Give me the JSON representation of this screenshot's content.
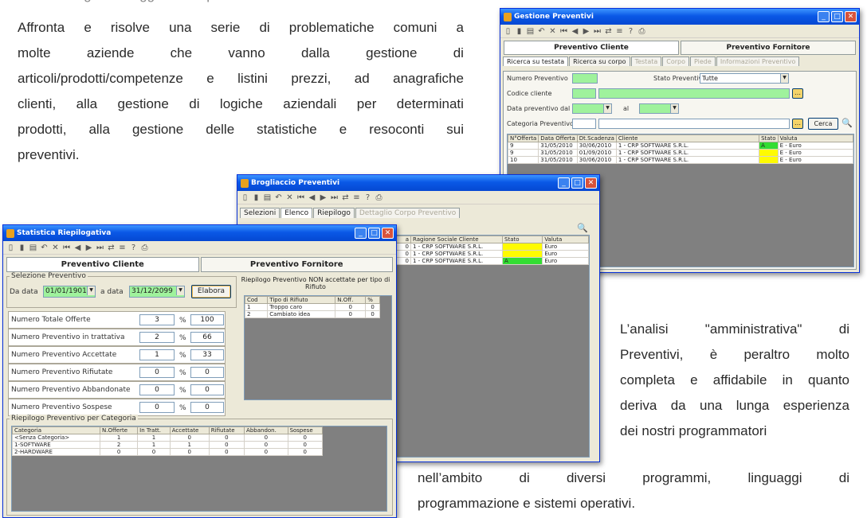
{
  "article": {
    "top_fragment": "con una seguirà in oggetto complicati ultima",
    "para1": [
      "Affronta e risolve una serie di problematiche comuni a",
      "molte aziende che vanno dalla gestione di",
      "articoli/prodotti/competenze e listini prezzi, ad anagrafiche",
      "clienti, alla gestione di logiche aziendali per determinati",
      "prodotti, alla gestione delle statistiche e resoconti sui",
      "preventivi."
    ],
    "para1_words": [
      [
        "Affronta",
        "e",
        "risolve",
        "una",
        "serie",
        "di",
        "problematiche",
        "comuni",
        "a"
      ],
      [
        "molte",
        "aziende",
        "che",
        "vanno",
        "dalla",
        "gestione",
        "di"
      ],
      [
        "articoli/prodotti/competenze",
        "e",
        "listini",
        "prezzi,",
        "ad",
        "anagrafiche"
      ],
      [
        "clienti,",
        "alla",
        "gestione",
        "di",
        "logiche",
        "aziendali",
        "per",
        "determinati"
      ],
      [
        "prodotti,",
        "alla",
        "gestione",
        "delle",
        "statistiche",
        "e",
        "resoconti",
        "sui"
      ]
    ],
    "para2_words": [
      [
        "L’analisi",
        "\"amministrativa\"",
        "di"
      ],
      [
        "Preventivi,",
        "è",
        "peraltro",
        "molto"
      ],
      [
        "completa",
        "e",
        "affidabile",
        "in",
        "quanto"
      ],
      [
        "deriva",
        "da",
        "una",
        "lunga",
        "esperienza"
      ]
    ],
    "para2_last": "dei nostri programmatori",
    "para3_words": [
      [
        "nell’ambito",
        "di",
        "diversi",
        "programmi,",
        "linguaggi",
        "di"
      ]
    ],
    "para3_last": "programmazione e sistemi operativi."
  },
  "win_gestione": {
    "title": "Gestione Preventivi",
    "big_tabs": [
      "Preventivo Cliente",
      "Preventivo Fornitore"
    ],
    "tabs": [
      "Ricerca su testata",
      "Ricerca su corpo",
      "Testata",
      "Corpo",
      "Piede",
      "Informazioni Preventivo"
    ],
    "lbl_numero": "Numero Preventivo",
    "lbl_stato": "Stato Preventivo",
    "stato_value": "Tutte",
    "lbl_cliente": "Codice cliente",
    "lbl_data": "Data preventivo dal",
    "lbl_al": "al",
    "lbl_categoria": "Categoria Preventivo",
    "btn_cerca": "Cerca",
    "columns": [
      "N°Offerta",
      "Data Offerta",
      "Dt.Scadenza",
      "Cliente",
      "Stato",
      "Valuta"
    ],
    "rows": [
      [
        "9",
        "31/05/2010",
        "30/06/2010",
        "1 - CRP SOFTWARE S.R.L.",
        "A",
        "E - Euro"
      ],
      [
        "9",
        "31/05/2010",
        "01/09/2010",
        "1 - CRP SOFTWARE S.R.L.",
        "",
        "E - Euro"
      ],
      [
        "10",
        "31/05/2010",
        "30/06/2010",
        "1 - CRP SOFTWARE S.R.L.",
        "",
        "E - Euro"
      ]
    ]
  },
  "win_brogliaccio": {
    "title": "Brogliaccio Preventivi",
    "tabs": [
      "Selezioni",
      "Elenco",
      "Riepilogo",
      "Dettaglio Corpo Preventivo"
    ],
    "columns": [
      "a",
      "Ragione Sociale Cliente",
      "Stato",
      "Valuta"
    ],
    "rows": [
      [
        "0",
        "1 - CRP SOFTWARE S.R.L.",
        "",
        "Euro"
      ],
      [
        "0",
        "1 - CRP SOFTWARE S.R.L.",
        "",
        "Euro"
      ],
      [
        "0",
        "1 - CRP SOFTWARE S.R.L.",
        "A",
        "Euro"
      ]
    ]
  },
  "win_statistica": {
    "title": "Statistica Riepilogativa",
    "big_tabs": [
      "Preventivo Cliente",
      "Preventivo Fornitore"
    ],
    "group_sel": "Selezione Preventivo",
    "lbl_da": "Da data",
    "da_value": "01/01/1901",
    "lbl_a": "a data",
    "a_value": "31/12/2099",
    "btn_elabora": "Elabora",
    "stats": [
      [
        "Numero Totale Offerte",
        "3",
        "100"
      ],
      [
        "Numero Preventivo in trattativa",
        "2",
        "66"
      ],
      [
        "Numero Preventivo Accettate",
        "1",
        "33"
      ],
      [
        "Numero Preventivo Rifiutate",
        "0",
        "0"
      ],
      [
        "Numero Preventivo Abbandonate",
        "0",
        "0"
      ],
      [
        "Numero Preventivo Sospese",
        "0",
        "0"
      ]
    ],
    "pct": "%",
    "rifiuto_title": "Riepilogo Preventivo NON accettate per tipo di Rifiuto",
    "rifiuto_cols": [
      "Cod",
      "Tipo di Rifiuto",
      "N.Off.",
      "%"
    ],
    "rifiuto_rows": [
      [
        "1",
        "Troppo caro",
        "0",
        "0"
      ],
      [
        "2",
        "Cambiato idea",
        "0",
        "0"
      ]
    ],
    "cat_title": "Riepilogo Preventivo per Categoria",
    "cat_cols": [
      "Categoria",
      "N.Offerte",
      "In Tratt.",
      "Accettate",
      "Rifiutate",
      "Abbandon.",
      "Sospese"
    ],
    "cat_rows": [
      [
        "<Senza Categoria>",
        "1",
        "1",
        "0",
        "0",
        "0",
        "0"
      ],
      [
        "1-SOFTWARE",
        "2",
        "1",
        "1",
        "0",
        "0",
        "0"
      ],
      [
        "2-HARDWARE",
        "0",
        "0",
        "0",
        "0",
        "0",
        "0"
      ]
    ]
  },
  "colors": {
    "titlebar": "#0a58e6",
    "input_green": "#9ff29c",
    "status_yellow": "#fffb00",
    "status_green": "#33dd33"
  },
  "icons": [
    "app-icon",
    "minimize-icon",
    "maximize-icon",
    "close-icon",
    "search-icon",
    "lookup-icon",
    "dropdown-icon"
  ]
}
